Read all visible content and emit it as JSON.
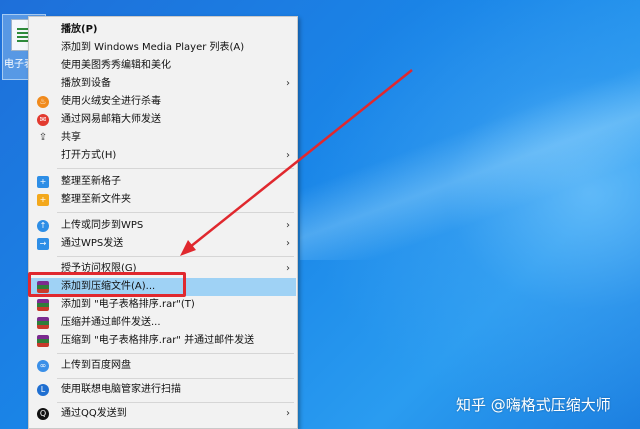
{
  "desktop_icon": {
    "label": "电子表"
  },
  "menu": {
    "items": [
      {
        "label": "播放(P)",
        "bold": true,
        "icon": "",
        "icon_color": ""
      },
      {
        "label": "添加到 Windows Media Player 列表(A)",
        "icon": "",
        "icon_color": ""
      },
      {
        "label": "使用美图秀秀编辑和美化",
        "icon": "",
        "icon_color": ""
      },
      {
        "label": "播放到设备",
        "submenu": true,
        "icon": "",
        "icon_color": ""
      },
      {
        "label": "使用火绒安全进行杀毒",
        "icon": "flame-icon",
        "icon_color": "#f08a1c"
      },
      {
        "label": "通过网易邮箱大师发送",
        "icon": "mail-master-icon",
        "icon_color": "#e23a2f"
      },
      {
        "label": "共享",
        "icon": "share-icon",
        "icon_color": "#333333"
      },
      {
        "label": "打开方式(H)",
        "submenu": true,
        "icon": "",
        "icon_color": ""
      },
      {
        "label": "整理至新格子",
        "icon": "grid-plus-icon",
        "icon_color": "#2e8ee6"
      },
      {
        "label": "整理至新文件夹",
        "icon": "folder-plus-icon",
        "icon_color": "#f3a81c"
      },
      {
        "label": "上传或同步到WPS",
        "submenu": true,
        "icon": "cloud-upload-icon",
        "icon_color": "#2e8ee6"
      },
      {
        "label": "通过WPS发送",
        "submenu": true,
        "icon": "send-icon",
        "icon_color": "#2e8ee6"
      },
      {
        "label": "授予访问权限(G)",
        "submenu": true,
        "icon": "",
        "icon_color": ""
      },
      {
        "label": "添加到压缩文件(A)...",
        "highlight": true,
        "icon": "rar-icon",
        "icon_color": ""
      },
      {
        "label": "添加到 \"电子表格排序.rar\"(T)",
        "icon": "rar-icon",
        "icon_color": ""
      },
      {
        "label": "压缩并通过邮件发送...",
        "icon": "rar-icon",
        "icon_color": ""
      },
      {
        "label": "压缩到 \"电子表格排序.rar\" 并通过邮件发送",
        "icon": "rar-icon",
        "icon_color": ""
      },
      {
        "label": "上传到百度网盘",
        "icon": "baidu-cloud-icon",
        "icon_color": "#3a8fe8"
      },
      {
        "label": "使用联想电脑管家进行扫描",
        "icon": "lenovo-shield-icon",
        "icon_color": "#1f6fd1"
      },
      {
        "label": "通过QQ发送到",
        "submenu": true,
        "icon": "qq-icon",
        "icon_color": "#111111"
      }
    ]
  },
  "watermark": "知乎 @嗨格式压缩大师",
  "colors": {
    "highlight": "#9fd2f5",
    "annotation_red": "#e0282e"
  }
}
